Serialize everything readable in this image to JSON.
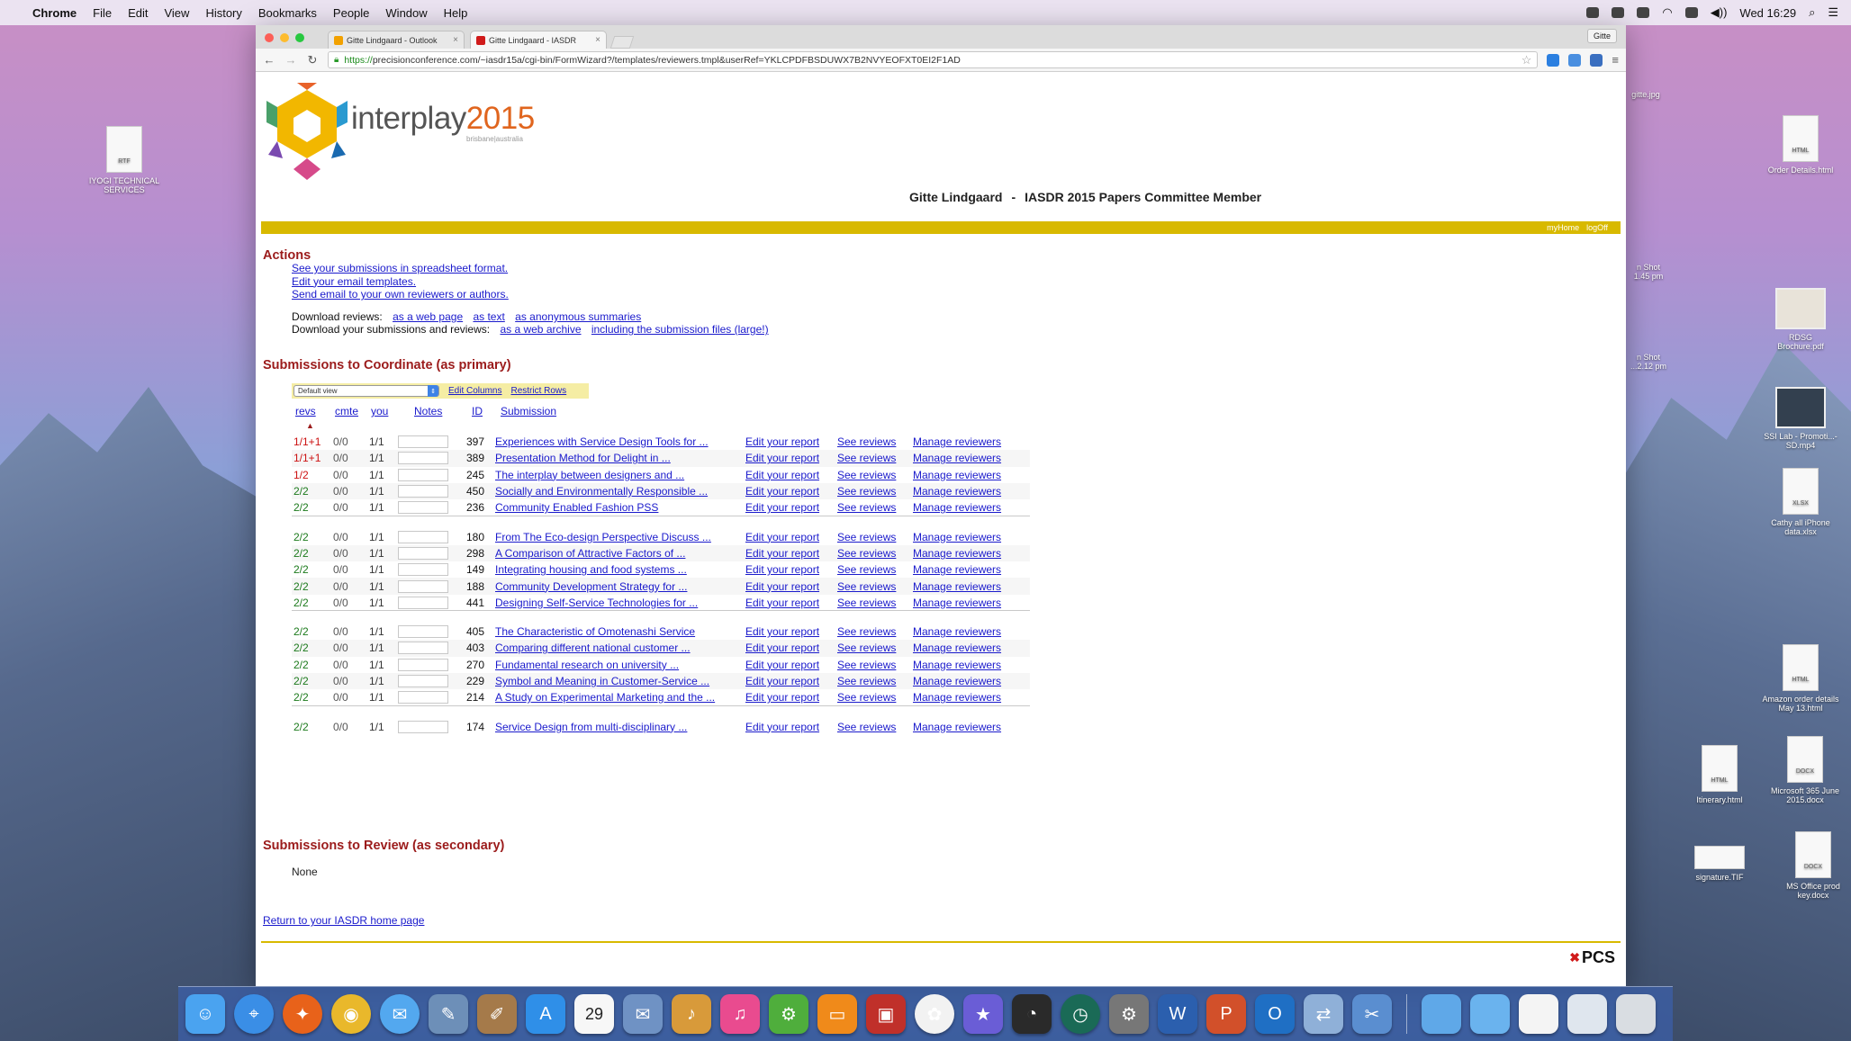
{
  "menubar": {
    "app": "Chrome",
    "items": [
      "File",
      "Edit",
      "View",
      "History",
      "Bookmarks",
      "People",
      "Window",
      "Help"
    ],
    "clock": "Wed 16:29"
  },
  "browser": {
    "tabs": [
      {
        "label": "Gitte Lindgaard - Outlook",
        "favicon_color": "#f2a100"
      },
      {
        "label": "Gitte Lindgaard - IASDR",
        "favicon_color": "#d01a1a"
      }
    ],
    "profile": "Gitte",
    "url_scheme": "https://",
    "url_rest": "precisionconference.com/~iasdr15a/cgi-bin/FormWizard?/templates/reviewers.tmpl&userRef=YKLCPDFBSDUWX7B2NVYEOFXT0EI2F1AD"
  },
  "page": {
    "logo_text": "interplay",
    "logo_year": "2015",
    "logo_sub": "brisbane|australia",
    "member_name": "Gitte Lindgaard",
    "member_sep": "-",
    "member_role": "IASDR 2015 Papers Committee Member",
    "top_links": [
      "myHome",
      "logOff"
    ],
    "actions_heading": "Actions",
    "action_links": [
      "See your submissions in spreadsheet format.",
      "Edit your email templates.",
      "Send email to your own reviewers or authors."
    ],
    "download_reviews_label": "Download reviews:",
    "download_reviews_links": [
      "as a web page",
      "as text",
      "as anonymous summaries"
    ],
    "download_subs_label": "Download your submissions and reviews:",
    "download_subs_links": [
      "as a web archive",
      "including the submission files (large!)"
    ],
    "primary_heading": "Submissions to Coordinate (as primary)",
    "view_select": "Default view",
    "edit_columns": "Edit Columns",
    "restrict_rows": "Restrict Rows",
    "columns": {
      "revs": "revs",
      "cmte": "cmte",
      "you": "you",
      "notes": "Notes",
      "id": "ID",
      "submission": "Submission"
    },
    "sort_indicator": "▲",
    "row_actions": {
      "edit": "Edit your report",
      "see": "See reviews",
      "manage": "Manage reviewers"
    },
    "groups": [
      [
        {
          "revs": "1/1+1",
          "status": "red",
          "cmte": "0/0",
          "you": "1/1",
          "id": "397",
          "title": "Experiences with Service Design Tools for ..."
        },
        {
          "revs": "1/1+1",
          "status": "red",
          "cmte": "0/0",
          "you": "1/1",
          "id": "389",
          "title": "Presentation Method for Delight in ..."
        },
        {
          "revs": "1/2",
          "status": "red",
          "cmte": "0/0",
          "you": "1/1",
          "id": "245",
          "title": "The interplay between designers and ..."
        },
        {
          "revs": "2/2",
          "status": "green",
          "cmte": "0/0",
          "you": "1/1",
          "id": "450",
          "title": "Socially and Environmentally Responsible ..."
        },
        {
          "revs": "2/2",
          "status": "green",
          "cmte": "0/0",
          "you": "1/1",
          "id": "236",
          "title": "Community Enabled Fashion PSS"
        }
      ],
      [
        {
          "revs": "2/2",
          "status": "green",
          "cmte": "0/0",
          "you": "1/1",
          "id": "180",
          "title": "From The Eco-design Perspective Discuss ..."
        },
        {
          "revs": "2/2",
          "status": "green",
          "cmte": "0/0",
          "you": "1/1",
          "id": "298",
          "title": "A Comparison of Attractive Factors of ..."
        },
        {
          "revs": "2/2",
          "status": "green",
          "cmte": "0/0",
          "you": "1/1",
          "id": "149",
          "title": "Integrating housing and food systems ..."
        },
        {
          "revs": "2/2",
          "status": "green",
          "cmte": "0/0",
          "you": "1/1",
          "id": "188",
          "title": "Community Development Strategy for ..."
        },
        {
          "revs": "2/2",
          "status": "green",
          "cmte": "0/0",
          "you": "1/1",
          "id": "441",
          "title": "Designing Self-Service Technologies for ..."
        }
      ],
      [
        {
          "revs": "2/2",
          "status": "green",
          "cmte": "0/0",
          "you": "1/1",
          "id": "405",
          "title": "The Characteristic of Omotenashi Service"
        },
        {
          "revs": "2/2",
          "status": "green",
          "cmte": "0/0",
          "you": "1/1",
          "id": "403",
          "title": "Comparing different national customer ..."
        },
        {
          "revs": "2/2",
          "status": "green",
          "cmte": "0/0",
          "you": "1/1",
          "id": "270",
          "title": "Fundamental research on university ..."
        },
        {
          "revs": "2/2",
          "status": "green",
          "cmte": "0/0",
          "you": "1/1",
          "id": "229",
          "title": "Symbol and Meaning in Customer-Service ..."
        },
        {
          "revs": "2/2",
          "status": "green",
          "cmte": "0/0",
          "you": "1/1",
          "id": "214",
          "title": "A Study on Experimental Marketing and the ..."
        }
      ],
      [
        {
          "revs": "2/2",
          "status": "green",
          "cmte": "0/0",
          "you": "1/1",
          "id": "174",
          "title": "Service Design from multi-disciplinary ..."
        }
      ]
    ],
    "secondary_heading": "Submissions to Review (as secondary)",
    "secondary_none": "None",
    "return_link": "Return to your IASDR home page",
    "footer_logo": "PCS"
  },
  "desktop": {
    "icons_left": [
      {
        "label": "IYOGI TECHNICAL SERVICES",
        "badge": "RTF"
      }
    ],
    "icons_right": [
      {
        "label": "gitte.jpg",
        "badge": ""
      },
      {
        "label": "Order Details.html",
        "badge": "HTML"
      },
      {
        "label": "n Shot 1.45 pm",
        "badge": ""
      },
      {
        "label": "n Shot ...2.12 pm",
        "badge": ""
      },
      {
        "label": "RDSG Brochure.pdf",
        "badge": ""
      },
      {
        "label": "SSI Lab - Promoti...-SD.mp4",
        "badge": ""
      },
      {
        "label": "Cathy all iPhone data.xlsx",
        "badge": "XLSX"
      },
      {
        "label": "Amazon order details May 13.html",
        "badge": "HTML"
      },
      {
        "label": "Itinerary.html",
        "badge": "HTML"
      },
      {
        "label": "Microsoft 365 June 2015.docx",
        "badge": "DOCX"
      },
      {
        "label": "signature.TIF",
        "badge": ""
      },
      {
        "label": "MS Office prod key.docx",
        "badge": "DOCX"
      }
    ]
  },
  "dock": {
    "calendar_day": "29",
    "apps": [
      {
        "name": "finder-icon",
        "color": "#4aa3f0",
        "glyph": "☺"
      },
      {
        "name": "safari-icon",
        "color": "#3a8ee6",
        "glyph": "⌖"
      },
      {
        "name": "firefox-icon",
        "color": "#e8621a",
        "glyph": "✦"
      },
      {
        "name": "chrome-icon",
        "color": "#e9b82b",
        "glyph": "◉"
      },
      {
        "name": "messages-icon",
        "color": "#53a8ef",
        "glyph": "✉"
      },
      {
        "name": "preview-icon",
        "color": "#6d8fb8",
        "glyph": "✎"
      },
      {
        "name": "notes-icon",
        "color": "#a57a4a",
        "glyph": "✐"
      },
      {
        "name": "app-store-icon",
        "color": "#2f8fe8",
        "glyph": "A"
      },
      {
        "name": "calendar-icon",
        "color": "#f7f7f7",
        "glyph": ""
      },
      {
        "name": "mail-icon",
        "color": "#6f92c4",
        "glyph": "✉"
      },
      {
        "name": "garageband-icon",
        "color": "#d89a3a",
        "glyph": "♪"
      },
      {
        "name": "itunes-icon",
        "color": "#e94b8f",
        "glyph": "♫"
      },
      {
        "name": "settings-gear-icon",
        "color": "#4fae3c",
        "glyph": "⚙"
      },
      {
        "name": "ibooks-icon",
        "color": "#f08a1a",
        "glyph": "▭"
      },
      {
        "name": "photo-booth-icon",
        "color": "#c0302a",
        "glyph": "▣"
      },
      {
        "name": "photos-icon",
        "color": "#f2f2f2",
        "glyph": "✿"
      },
      {
        "name": "imovie-icon",
        "color": "#6a5dd6",
        "glyph": "★"
      },
      {
        "name": "dashboard-icon",
        "color": "#2a2a2a",
        "glyph": "◔"
      },
      {
        "name": "time-machine-icon",
        "color": "#1a6a56",
        "glyph": "◷"
      },
      {
        "name": "system-preferences-icon",
        "color": "#777777",
        "glyph": "⚙"
      },
      {
        "name": "word-icon",
        "color": "#2b5fae",
        "glyph": "W"
      },
      {
        "name": "powerpoint-icon",
        "color": "#d2502a",
        "glyph": "P"
      },
      {
        "name": "outlook-icon",
        "color": "#1f6fc4",
        "glyph": "O"
      },
      {
        "name": "migration-icon",
        "color": "#8fb0d8",
        "glyph": "⇄"
      },
      {
        "name": "utilities-icon",
        "color": "#5a8ed0",
        "glyph": "✂"
      }
    ],
    "folders": [
      {
        "name": "applications-folder-icon",
        "color": "#5fa8e8"
      },
      {
        "name": "documents-folder-icon",
        "color": "#6ab3ee"
      },
      {
        "name": "document-icon",
        "color": "#f4f4f4"
      },
      {
        "name": "downloads-stack-icon",
        "color": "#dfe6ee"
      },
      {
        "name": "trash-icon",
        "color": "#d9dde2"
      }
    ]
  }
}
